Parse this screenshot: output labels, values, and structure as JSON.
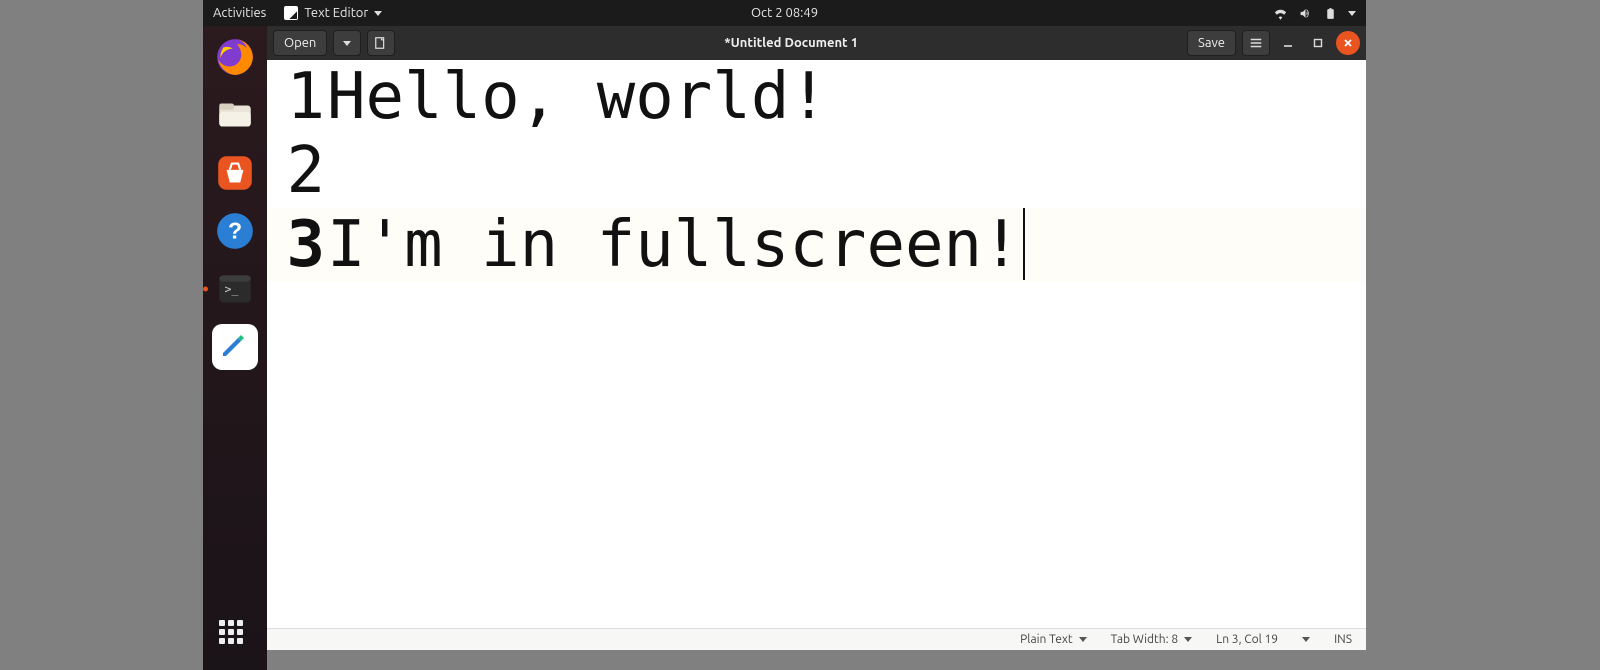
{
  "topbar": {
    "activities": "Activities",
    "app_name": "Text Editor",
    "clock": "Oct 2  08:49"
  },
  "dock": {
    "items": [
      {
        "name": "firefox"
      },
      {
        "name": "files"
      },
      {
        "name": "software"
      },
      {
        "name": "help"
      },
      {
        "name": "terminal"
      },
      {
        "name": "text-editor"
      }
    ]
  },
  "window": {
    "open_label": "Open",
    "title": "*Untitled Document 1",
    "save_label": "Save"
  },
  "editor": {
    "lines": [
      {
        "n": "1",
        "text": "Hello, world!"
      },
      {
        "n": "2",
        "text": ""
      },
      {
        "n": "3",
        "text": "I'm in fullscreen!"
      }
    ],
    "current_line_index": 2
  },
  "statusbar": {
    "syntax": "Plain Text",
    "tabwidth": "Tab Width: 8",
    "position": "Ln 3, Col 19",
    "insmode": "INS"
  }
}
